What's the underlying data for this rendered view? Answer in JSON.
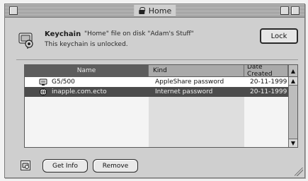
{
  "window": {
    "title": "Home"
  },
  "header": {
    "keychain_name": "Keychain",
    "keychain_description": "\"Home\" file on disk \"Adam's Stuff\"",
    "status": "This keychain is unlocked.",
    "lock_button_label": "Lock"
  },
  "list": {
    "columns": {
      "name": "Name",
      "kind": "Kind",
      "date": "Date Created",
      "sort_indicator": "▲"
    },
    "rows": [
      {
        "icon": "appleshare-icon",
        "name": "G5/500",
        "kind": "AppleShare password",
        "date": "20-11-1999"
      },
      {
        "icon": "internet-icon",
        "name": "inapple.com.ecto",
        "kind": "Internet password",
        "date": "20-11-1999"
      }
    ]
  },
  "footer": {
    "get_info_label": "Get Info",
    "remove_label": "Remove"
  },
  "colors": {
    "selection": "#4c4c4c",
    "window_bg": "#cfcfcf",
    "list_bg": "#f4f4f4"
  }
}
